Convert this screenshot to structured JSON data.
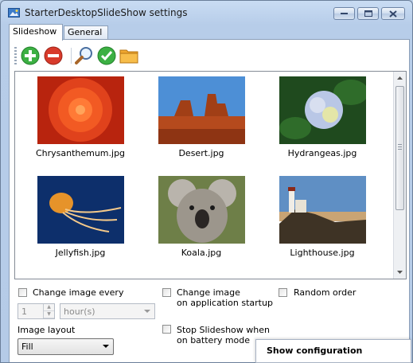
{
  "window": {
    "title": "StarterDesktopSlideShow settings"
  },
  "tabs": [
    {
      "label": "Slideshow"
    },
    {
      "label": "General"
    }
  ],
  "toolbar": {
    "icons": [
      "add-icon",
      "remove-icon",
      "search-icon",
      "check-icon",
      "folder-icon"
    ]
  },
  "images": [
    {
      "caption": "Chrysanthemum.jpg"
    },
    {
      "caption": "Desert.jpg"
    },
    {
      "caption": "Hydrangeas.jpg"
    },
    {
      "caption": "Jellyfish.jpg"
    },
    {
      "caption": "Koala.jpg"
    },
    {
      "caption": "Lighthouse.jpg"
    }
  ],
  "options": {
    "change_every_label": "Change image every",
    "interval_value": "1",
    "interval_unit": "hour(s)",
    "startup_label_1": "Change image",
    "startup_label_2": "on application startup",
    "random_label": "Random order",
    "battery_label_1": "Stop Slideshow when",
    "battery_label_2": "on battery mode",
    "layout_label": "Image layout",
    "layout_value": "Fill"
  },
  "context_menu": {
    "label": "Show configuration"
  },
  "colors": {
    "accent_green": "#3cb043",
    "accent_red": "#d83a2b",
    "folder": "#f0a830"
  }
}
